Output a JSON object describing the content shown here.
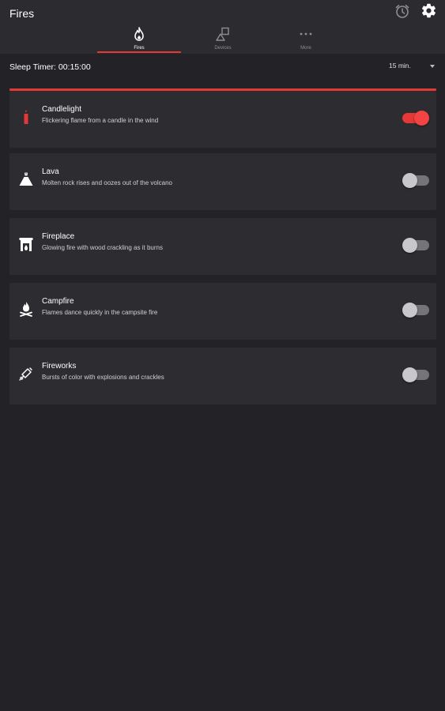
{
  "app": {
    "title": "Fires"
  },
  "header_icons": {
    "alarm": "alarm-clock-icon",
    "settings": "gear-icon"
  },
  "tabs": [
    {
      "label": "Fires",
      "icon": "flame-icon",
      "active": true
    },
    {
      "label": "Devices",
      "icon": "devices-icon",
      "active": false
    },
    {
      "label": "More",
      "icon": "more-dots-icon",
      "active": false
    }
  ],
  "sleep_timer": {
    "label": "Sleep Timer: 00:15:00",
    "selected": "15 min."
  },
  "sounds": [
    {
      "title": "Candlelight",
      "description": "Flickering flame from a candle in the wind",
      "icon": "candle-icon",
      "on": true
    },
    {
      "title": "Lava",
      "description": "Molten rock rises and oozes out of the volcano",
      "icon": "volcano-icon",
      "on": false
    },
    {
      "title": "Fireplace",
      "description": "Glowing fire with wood crackling as it burns",
      "icon": "fireplace-icon",
      "on": false
    },
    {
      "title": "Campfire",
      "description": "Flames dance quickly in the campsite fire",
      "icon": "campfire-icon",
      "on": false
    },
    {
      "title": "Fireworks",
      "description": "Bursts of color with explosions and crackles",
      "icon": "firework-rocket-icon",
      "on": false
    }
  ],
  "colors": {
    "accent": "#e53935",
    "background": "#232327",
    "card": "#2c2c31",
    "appbar": "#2b2b30"
  }
}
